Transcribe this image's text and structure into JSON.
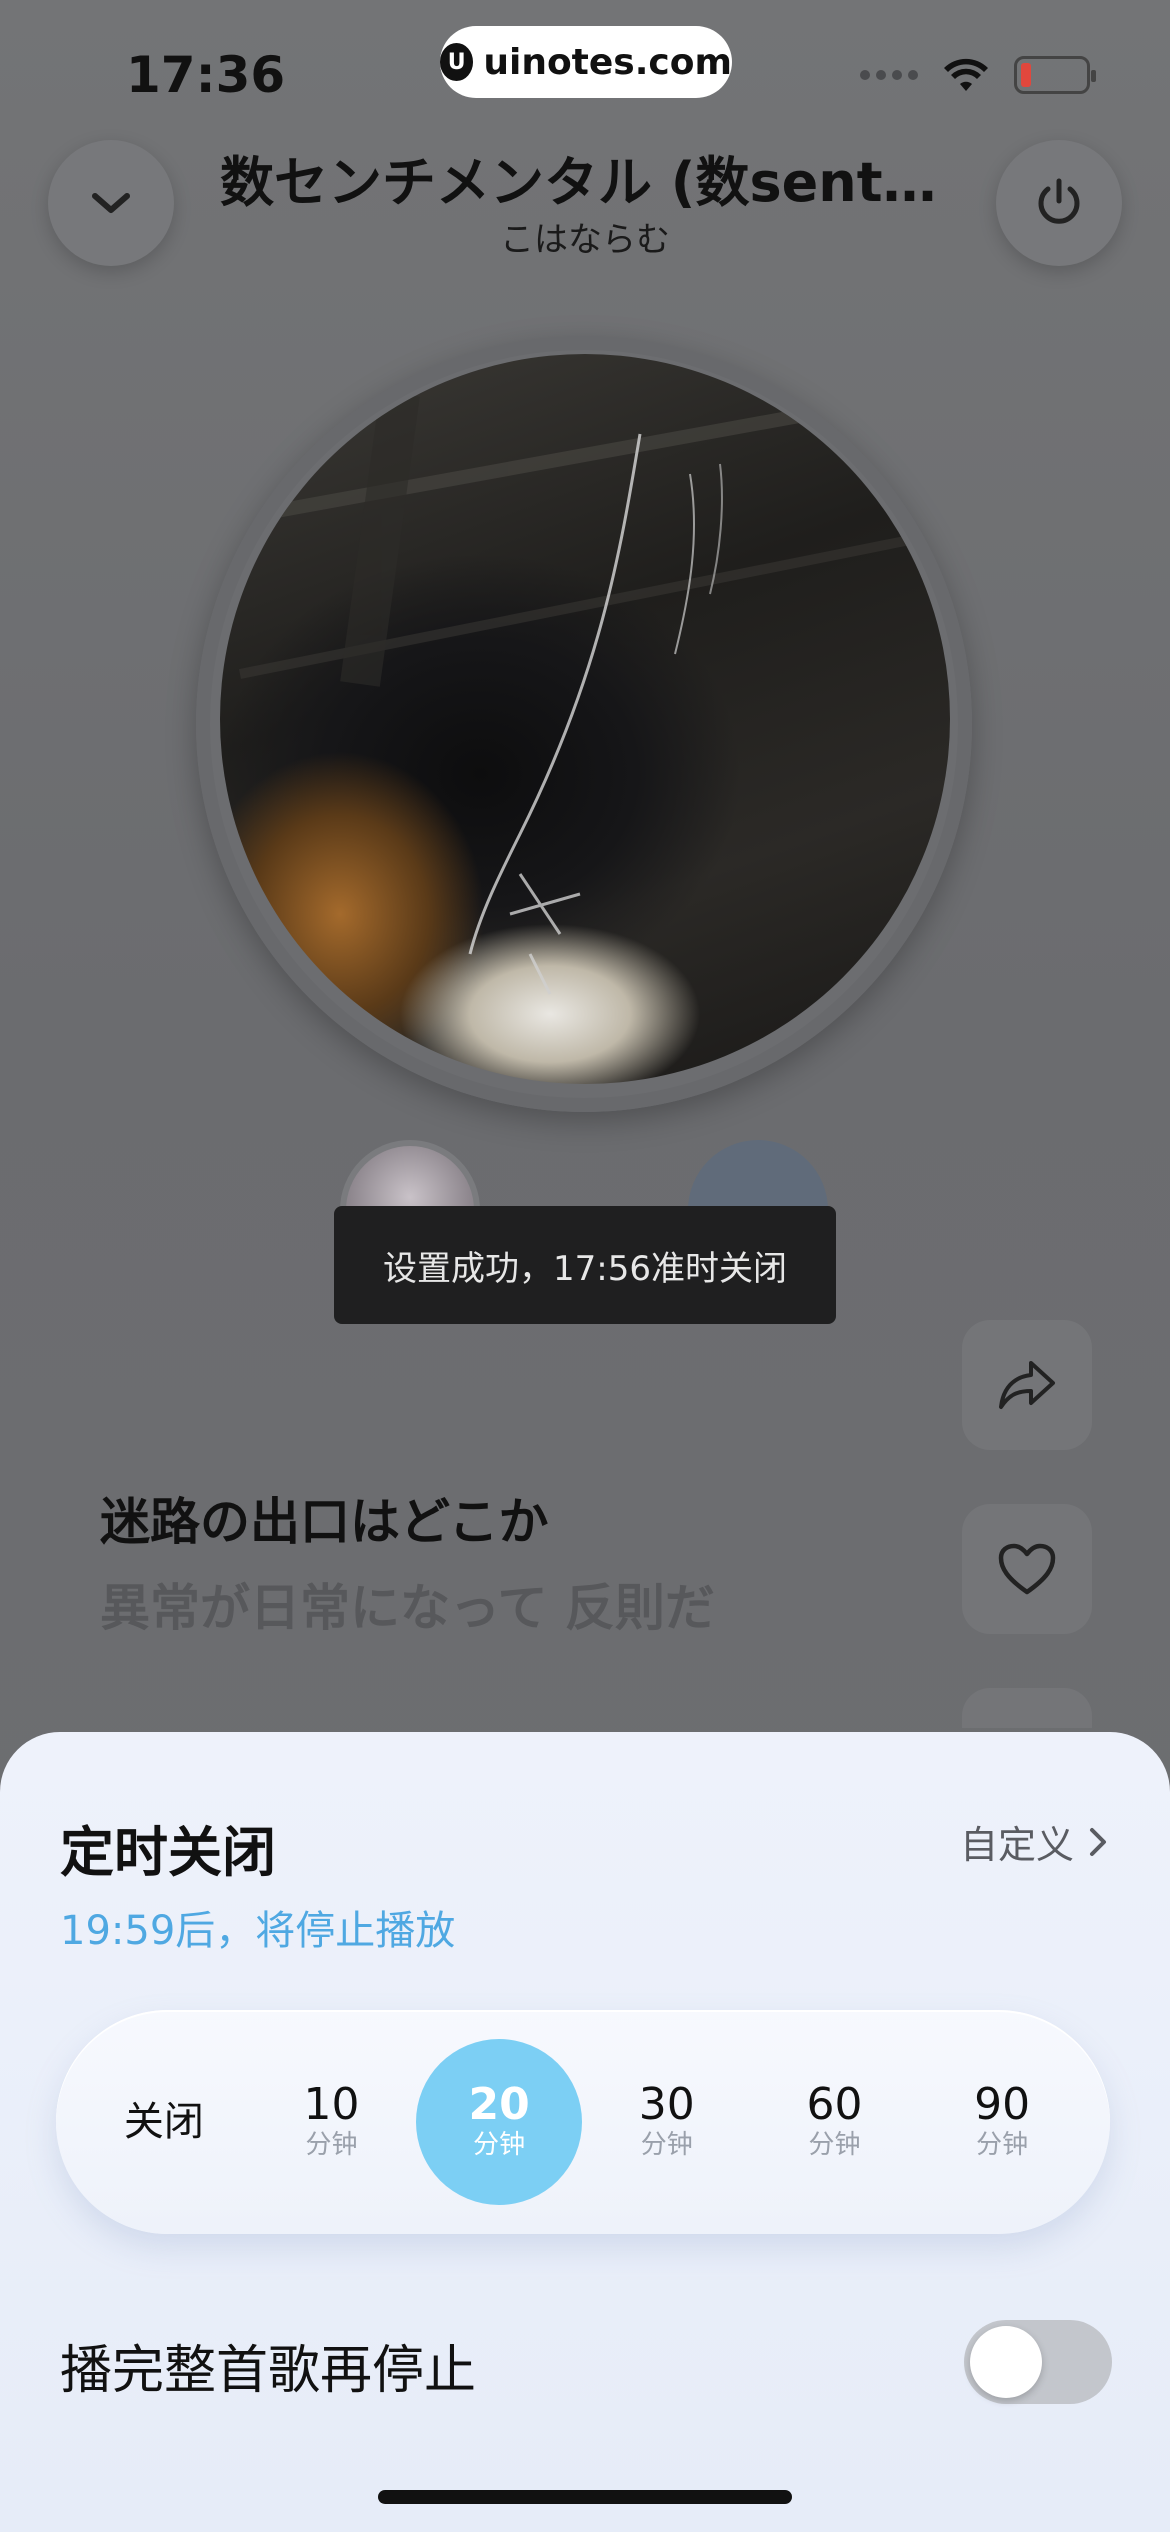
{
  "status_bar": {
    "time": "17:36",
    "watermark": "uinotes.com"
  },
  "player": {
    "title": "数センチメンタル (数sentimental)",
    "artist": "こはならむ",
    "lyrics": [
      "迷路の出口はどこか",
      "異常が日常になって 反則だ"
    ]
  },
  "toast": {
    "text": "设置成功，17:56准时关闭"
  },
  "sleep_timer": {
    "title": "定时关闭",
    "custom_label": "自定义",
    "subtitle": "19:59后，将停止播放",
    "options": [
      {
        "num": "关闭",
        "unit": ""
      },
      {
        "num": "10",
        "unit": "分钟"
      },
      {
        "num": "20",
        "unit": "分钟"
      },
      {
        "num": "30",
        "unit": "分钟"
      },
      {
        "num": "60",
        "unit": "分钟"
      },
      {
        "num": "90",
        "unit": "分钟"
      }
    ],
    "selected_index": 2,
    "finish_song_label": "播完整首歌再停止",
    "finish_song_enabled": false
  },
  "colors": {
    "accent": "#7ccff4",
    "subtitle": "#4fa8e2"
  },
  "icons": [
    "chevron-down-icon",
    "power-icon",
    "share-icon",
    "heart-icon",
    "chevron-right-icon",
    "wifi-icon",
    "battery-icon"
  ]
}
